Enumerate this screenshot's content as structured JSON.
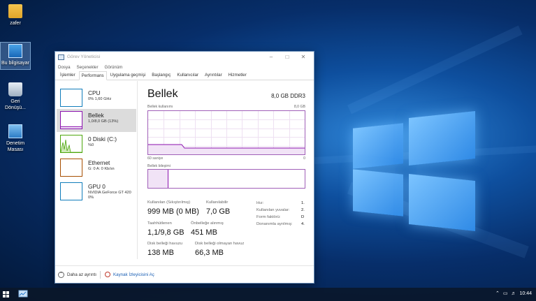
{
  "desktop": {
    "icons": [
      {
        "label": "zafer"
      },
      {
        "label": "Bu bilgisayar"
      },
      {
        "label": "Geri Dönüşü..."
      },
      {
        "label": "Denetim Masası"
      }
    ]
  },
  "window": {
    "title": "Görev Yöneticisi",
    "menu": [
      "Dosya",
      "Seçenekler",
      "Görünüm"
    ],
    "tabs": [
      "İşlemler",
      "Performans",
      "Uygulama geçmişi",
      "Başlangıç",
      "Kullanıcılar",
      "Ayrıntılar",
      "Hizmetler"
    ],
    "active_tab": "Performans"
  },
  "sidebar": {
    "items": [
      {
        "name": "CPU",
        "sub": "0%  1,60 GHz",
        "color": "#117dbb"
      },
      {
        "name": "Bellek",
        "sub": "1,0/8,0 GB (13%)",
        "color": "#8b12ae"
      },
      {
        "name": "0 Diski (C:)",
        "sub": "%0",
        "color": "#4da60c"
      },
      {
        "name": "Ethernet",
        "sub": "G: 0  A: 0 Kb/sn",
        "color": "#a74f01"
      },
      {
        "name": "GPU 0",
        "sub": "NVIDIA GeForce GT 420\n0%",
        "color": "#117dbb"
      }
    ]
  },
  "main": {
    "title": "Bellek",
    "spec": "8,0 GB DDR3",
    "usage_label": "Bellek kullanımı",
    "usage_max": "8,0 GB",
    "time_label": "60 saniye",
    "time_end": "0",
    "composition_label": "Bellek bileşimi",
    "usage_fraction": 0.13,
    "stats": {
      "in_use_label": "Kullanılan (Sıkıştırılmış)",
      "in_use_value": "999 MB (0 MB)",
      "available_label": "Kullanılabilir",
      "available_value": "7,0 GB",
      "committed_label": "Taahhütlenen",
      "committed_value": "1,1/9,8 GB",
      "cached_label": "Önbelleğe alınmış",
      "cached_value": "451 MB",
      "paged_label": "Disk belleği havuzu",
      "paged_value": "138 MB",
      "nonpaged_label": "Disk belleği olmayan havuz",
      "nonpaged_value": "66,3 MB"
    },
    "details": [
      {
        "label": "Hız:",
        "value": "1."
      },
      {
        "label": "Kullanılan yuvalar:",
        "value": "2."
      },
      {
        "label": "Form faktörü:",
        "value": "D"
      },
      {
        "label": "Donanımla ayrılmış:",
        "value": "4."
      }
    ]
  },
  "footer": {
    "fewer_details": "Daha az ayrıntı",
    "resource_monitor": "Kaynak İzleyicisini Aç"
  },
  "taskbar": {
    "clock": "10:44"
  }
}
